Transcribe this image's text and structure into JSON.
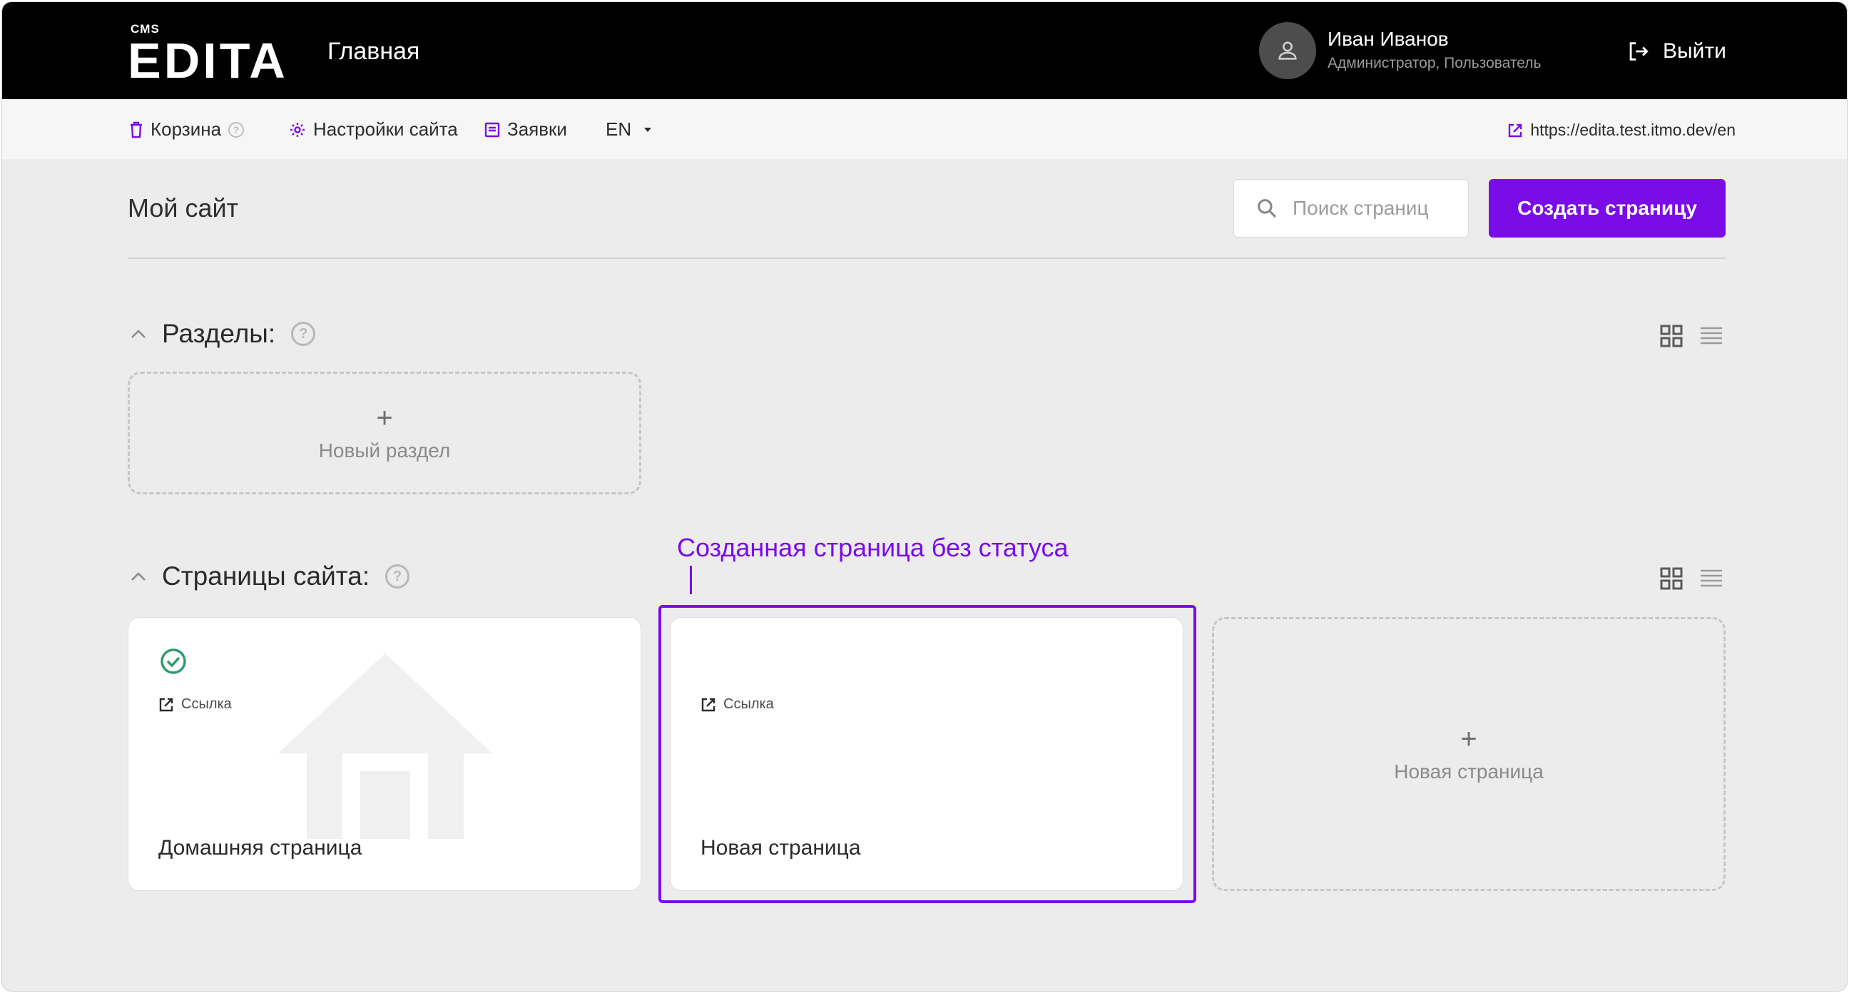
{
  "header": {
    "logo_small": "CMS",
    "logo_main": "EDITA",
    "title": "Главная",
    "user_name": "Иван Иванов",
    "user_role": "Администратор, Пользователь",
    "logout_label": "Выйти"
  },
  "toolbar": {
    "trash_label": "Корзина",
    "settings_label": "Настройки сайта",
    "requests_label": "Заявки",
    "language": "EN",
    "site_url": "https://edita.test.itmo.dev/en"
  },
  "main": {
    "title": "Мой сайт",
    "search_placeholder": "Поиск страниц",
    "create_button": "Создать страницу"
  },
  "sections": {
    "heading": "Разделы:",
    "new_section_label": "Новый раздел"
  },
  "pages": {
    "heading": "Страницы сайта:",
    "items": [
      {
        "name": "Домашняя страница",
        "link_label": "Ссылка",
        "status": "published"
      },
      {
        "name": "Новая страница",
        "link_label": "Ссылка",
        "status": "none"
      }
    ],
    "new_page_label": "Новая страница"
  },
  "annotation": {
    "text": "Созданная страница без статуса"
  },
  "colors": {
    "accent": "#7a0ce8",
    "header_bg": "#000000",
    "status_ok": "#2e9b6f"
  }
}
